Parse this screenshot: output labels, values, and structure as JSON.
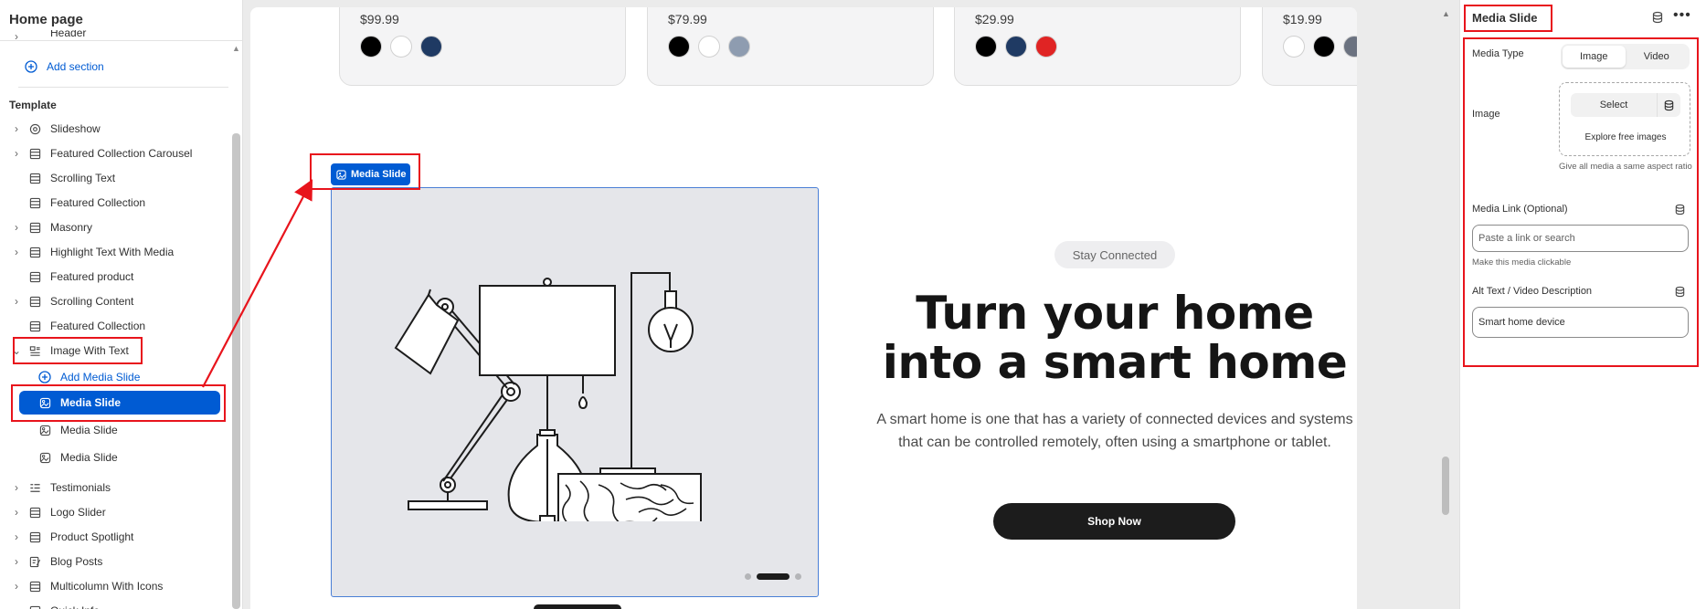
{
  "sidebar": {
    "title": "Home page",
    "header_item": "Header",
    "add_section": "Add section",
    "template_label": "Template",
    "items": [
      {
        "label": "Slideshow",
        "icon": "slideshow-icon",
        "chev": true
      },
      {
        "label": "Featured Collection Carousel",
        "icon": "section-icon",
        "chev": true
      },
      {
        "label": "Scrolling Text",
        "icon": "section-icon",
        "chev": false
      },
      {
        "label": "Featured Collection",
        "icon": "section-icon",
        "chev": false
      },
      {
        "label": "Masonry",
        "icon": "section-icon",
        "chev": true
      },
      {
        "label": "Highlight Text With Media",
        "icon": "section-icon",
        "chev": true
      },
      {
        "label": "Featured product",
        "icon": "section-icon",
        "chev": false
      },
      {
        "label": "Scrolling Content",
        "icon": "section-icon",
        "chev": true
      },
      {
        "label": "Featured Collection",
        "icon": "section-icon",
        "chev": false
      },
      {
        "label": "Image With Text",
        "icon": "image-text-icon",
        "chev": true
      }
    ],
    "add_media_slide": "Add Media Slide",
    "media_slides": [
      "Media Slide",
      "Media Slide",
      "Media Slide"
    ],
    "items_after": [
      {
        "label": "Testimonials",
        "icon": "testimonials-icon"
      },
      {
        "label": "Logo Slider",
        "icon": "section-icon"
      },
      {
        "label": "Product Spotlight",
        "icon": "section-icon"
      },
      {
        "label": "Blog Posts",
        "icon": "blog-icon"
      },
      {
        "label": "Multicolumn With Icons",
        "icon": "section-icon"
      },
      {
        "label": "Quick Info",
        "icon": "section-icon"
      }
    ]
  },
  "canvas": {
    "products": [
      {
        "price": "$99.99",
        "swatches": [
          "#000000",
          "#ffffff",
          "#1f3a63"
        ]
      },
      {
        "price": "$79.99",
        "swatches": [
          "#000000",
          "#ffffff",
          "#8e9cb0"
        ]
      },
      {
        "price": "$29.99",
        "swatches": [
          "#000000",
          "#1f3a63",
          "#e02424"
        ]
      },
      {
        "price": "$19.99",
        "swatches": [
          "#ffffff",
          "#000000",
          "#6b7280"
        ]
      }
    ],
    "media_chip": "Media Slide",
    "badge": "Stay Connected",
    "headline_line1": "Turn your home",
    "headline_line2": "into a smart home",
    "description": "A smart home is one that has a variety of connected devices and systems that can be controlled remotely, often using a smartphone or tablet.",
    "cta": "Shop Now",
    "slider_dots": 3,
    "active_dot": 1
  },
  "panel": {
    "title": "Media Slide",
    "media_type_label": "Media Type",
    "media_type_options": [
      "Image",
      "Video"
    ],
    "media_type_selected": "Image",
    "image_label": "Image",
    "select_label": "Select",
    "explore_label": "Explore free images",
    "aspect_help": "Give all media a same aspect ratio",
    "link_label": "Media Link (Optional)",
    "link_placeholder": "Paste a link or search",
    "link_help": "Make this media clickable",
    "alt_label": "Alt Text / Video Description",
    "alt_value": "Smart home device"
  },
  "colors": {
    "accent": "#005bd3",
    "annotation": "#e8141c",
    "cta_bg": "#1c1c1c"
  }
}
